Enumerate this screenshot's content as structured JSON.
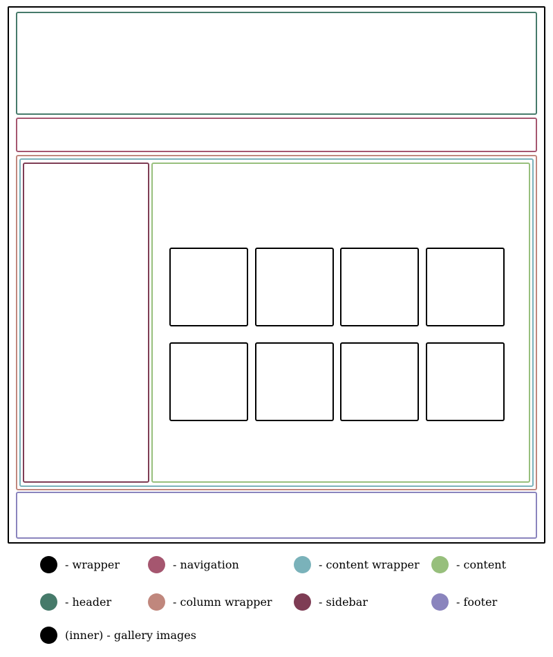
{
  "legend": [
    {
      "label": "- wrapper",
      "color": "#000000"
    },
    {
      "label": "- navigation",
      "color": "#a5566f"
    },
    {
      "label": "- content wrapper",
      "color": "#7ab2ba"
    },
    {
      "label": "- content",
      "color": "#97bf7c"
    },
    {
      "label": "- header",
      "color": "#467a6a"
    },
    {
      "label": "- column wrapper",
      "color": "#c0877d"
    },
    {
      "label": "- sidebar",
      "color": "#7e3c54"
    },
    {
      "label": "- footer",
      "color": "#8a84bd"
    },
    {
      "label": "(inner) - gallery images",
      "color": "#000000"
    }
  ],
  "gallery": {
    "rows": 2,
    "columns": 4
  }
}
